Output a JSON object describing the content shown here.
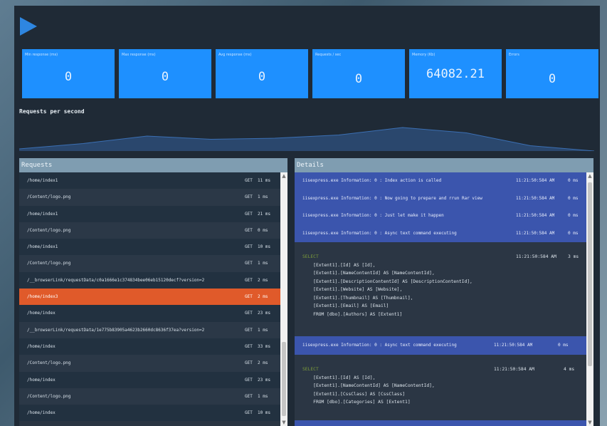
{
  "stats": [
    {
      "label": "Min response (ms)",
      "value": "0"
    },
    {
      "label": "Max response (ms)",
      "value": "0"
    },
    {
      "label": "Avg response (ms)",
      "value": "0"
    },
    {
      "label": "Requests / sec",
      "value": "0"
    },
    {
      "label": "Memory (Kb)",
      "value": "64082.21"
    },
    {
      "label": "Errors",
      "value": "0"
    }
  ],
  "chart": {
    "title": "Requests per second"
  },
  "chart_data": {
    "type": "area",
    "values": [
      2,
      7,
      14,
      11,
      12,
      15,
      22,
      17,
      5,
      0
    ]
  },
  "requests": {
    "title": "Requests",
    "rows": [
      {
        "path": "/home/index1",
        "method": "GET",
        "time": "11 ms"
      },
      {
        "path": "/Content/logo.png",
        "method": "GET",
        "time": "1 ms"
      },
      {
        "path": "/home/index1",
        "method": "GET",
        "time": "21 ms"
      },
      {
        "path": "/Content/logo.png",
        "method": "GET",
        "time": "0 ms"
      },
      {
        "path": "/home/index1",
        "method": "GET",
        "time": "10 ms"
      },
      {
        "path": "/Content/logo.png",
        "method": "GET",
        "time": "1 ms"
      },
      {
        "path": "/__browserLink/requestData/c0a1666e1c374834bee06eb15120decf?version=2",
        "method": "GET",
        "time": "2 ms"
      },
      {
        "path": "/home/index3",
        "method": "GET",
        "time": "2 ms"
      },
      {
        "path": "/home/index",
        "method": "GET",
        "time": "23 ms"
      },
      {
        "path": "/__browserLink/requestData/1e775b83905a4623b2660dc8636f37ea?version=2",
        "method": "GET",
        "time": "1 ms"
      },
      {
        "path": "/home/index",
        "method": "GET",
        "time": "33 ms"
      },
      {
        "path": "/Content/logo.png",
        "method": "GET",
        "time": "2 ms"
      },
      {
        "path": "/home/index",
        "method": "GET",
        "time": "23 ms"
      },
      {
        "path": "/Content/logo.png",
        "method": "GET",
        "time": "1 ms"
      },
      {
        "path": "/home/index",
        "method": "GET",
        "time": "10 ms"
      }
    ]
  },
  "details": {
    "title": "Details",
    "info_rows": [
      {
        "msg": "iisexpress.exe Information: 0 : Index action is called",
        "ts": "11:21:50:584 AM",
        "ms": "0 ms"
      },
      {
        "msg": "iisexpress.exe Information: 0 : Now going to prepare and rrun Rar view",
        "ts": "11:21:50:584 AM",
        "ms": "0 ms"
      },
      {
        "msg": "iisexpress.exe Information: 0 : Just let make it happen",
        "ts": "11:21:50:584 AM",
        "ms": "0 ms"
      },
      {
        "msg": "iisexpress.exe Information: 0 : Async text command executing",
        "ts": "11:21:50:584 AM",
        "ms": "0 ms"
      }
    ],
    "sql1": {
      "ts": "11:21:50:584 AM",
      "ms": "3 ms",
      "lines": [
        {
          "kw": "SELECT",
          "text": ""
        },
        {
          "kw": "",
          "text": "    [Extent1].[Id] AS [Id],"
        },
        {
          "kw": "",
          "text": "    [Extent1].[NameContentId] AS [NameContentId],"
        },
        {
          "kw": "",
          "text": "    [Extent1].[DescriptionContentId] AS [DescriptionContentId],"
        },
        {
          "kw": "",
          "text": "    [Extent1].[Website] AS [Website],"
        },
        {
          "kw": "",
          "text": "    [Extent1].[Thumbnail] AS [Thumbnail],"
        },
        {
          "kw": "",
          "text": "    [Extent1].[Email] AS [Email]"
        },
        {
          "kw": "",
          "text": "    FROM [dbo].[Authors] AS [Extent1]"
        }
      ]
    },
    "info_row_b": {
      "msg": "iisexpress.exe Information: 0 : Async text command executing",
      "ts": "11:21:50:584 AM",
      "ms": "0 ms"
    },
    "sql2": {
      "ts": "11:21:50:584 AM",
      "ms": "4 ms",
      "lines": [
        {
          "kw": "SELECT",
          "text": ""
        },
        {
          "kw": "",
          "text": "    [Extent1].[Id] AS [Id],"
        },
        {
          "kw": "",
          "text": "    [Extent1].[NameContentId] AS [NameContentId],"
        },
        {
          "kw": "",
          "text": "    [Extent1].[CssClass] AS [CssClass]"
        },
        {
          "kw": "",
          "text": "    FROM [dbo].[Categories] AS [Extent1]"
        }
      ]
    }
  },
  "colors": {
    "accent": "#1e90ff",
    "active": "#e05a2a",
    "header": "#7f9db1",
    "info": "#3b55ad"
  }
}
